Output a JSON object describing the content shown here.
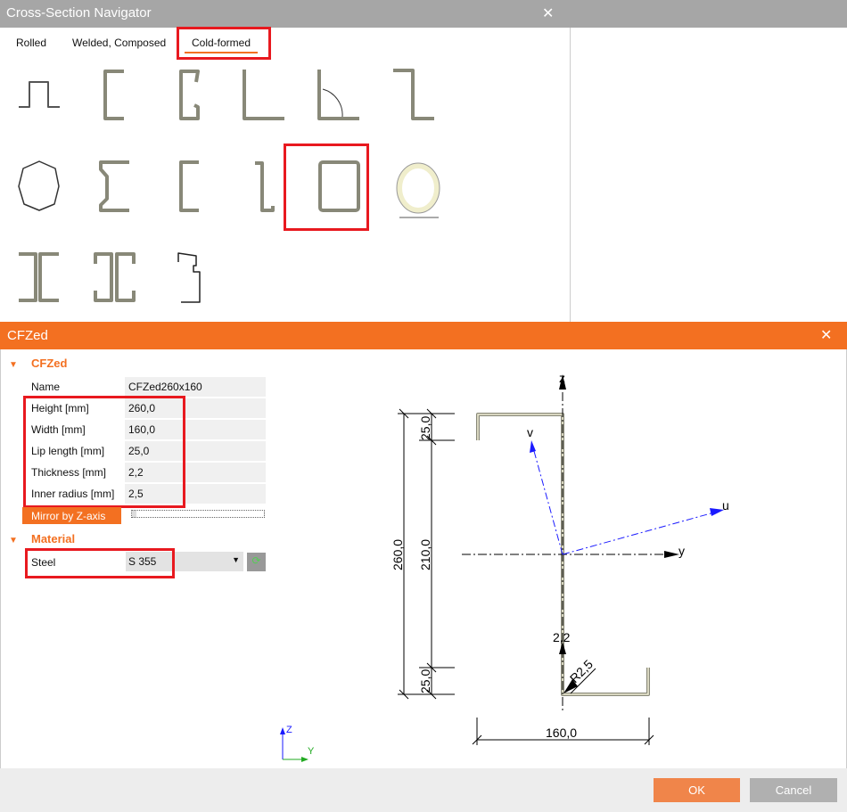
{
  "navigator": {
    "title": "Cross-Section Navigator",
    "tabs": [
      {
        "label": "Rolled"
      },
      {
        "label": "Welded, Composed"
      },
      {
        "label": "Cold-formed",
        "active": true
      }
    ],
    "shapes": [
      "hat",
      "channel-lipped",
      "channel-double-lipped",
      "angle",
      "angle-custom",
      "zed",
      "polygon",
      "sigma",
      "channel",
      "zed-lipped",
      "rectangular-tube",
      "circular-tube",
      "back-to-back-channel",
      "back-to-back-lipped-channel",
      "custom-profile"
    ],
    "selected": "zed-lipped"
  },
  "dialog": {
    "title": "CFZed",
    "section_label": "CFZed",
    "properties": [
      {
        "label": "Name",
        "value": "CFZed260x160"
      },
      {
        "label": "Height [mm]",
        "value": "260,0"
      },
      {
        "label": "Width [mm]",
        "value": "160,0"
      },
      {
        "label": "Lip length [mm]",
        "value": "25,0"
      },
      {
        "label": "Thickness [mm]",
        "value": "2,2"
      },
      {
        "label": "Inner radius [mm]",
        "value": "2,5"
      }
    ],
    "mirror_label": "Mirror by Z-axis",
    "material_label": "Material",
    "steel_label": "Steel",
    "steel_value": "S 355",
    "ok_label": "OK",
    "cancel_label": "Cancel"
  },
  "drawing": {
    "dims": {
      "height": "260,0",
      "web": "210,0",
      "lip_top": "25,0",
      "lip_bottom": "25,0",
      "width": "160,0",
      "thickness": "2,2",
      "radius": "R2,5"
    },
    "axes": {
      "z": "z",
      "y": "y",
      "u": "u",
      "v": "v"
    },
    "triad": {
      "z": "Z",
      "y": "Y"
    }
  },
  "colors": {
    "accent": "#f37021",
    "highlight": "#e8191f",
    "principal_axes": "#1a1aff"
  }
}
